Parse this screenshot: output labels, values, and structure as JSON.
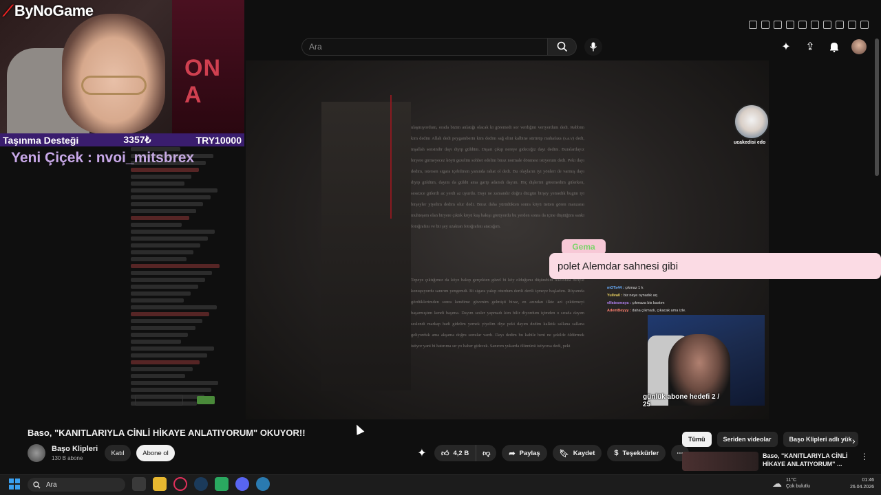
{
  "overlay": {
    "logo": "ByNoGame",
    "webcam_bg_text": "ON A",
    "donation": {
      "label": "Taşınma Desteği",
      "amount": "3357₺",
      "goal": "TRY10000"
    },
    "new_follower": "Yeni Çiçek : nvoi_mitsbrex",
    "bubble_name": "Gema",
    "bubble_message": "polet Alemdar sahnesi gibi",
    "sub_goal": "günlük abone hedefi 2 / 25",
    "cat_name": "ucakedisi edo",
    "right_chat": [
      {
        "user": "mOTs44 :",
        "text": "çıkmaz 1 k"
      },
      {
        "user": "Yullva0 :",
        "text": "biz neye oynadık aq"
      },
      {
        "user": "elfatesmaya :",
        "text": "çıkmaza bis bastım"
      },
      {
        "user": "AdemBeyyy :",
        "text": "daha çıkmadı, çıkacak ama izle."
      }
    ]
  },
  "header": {
    "search_placeholder": "Ara",
    "icons": [
      "upload-icon",
      "notifications-icon",
      "account-avatar"
    ]
  },
  "video": {
    "story_text_1": "ulaşmıyordum, orada bizim anlatığı olacak ki göremedi sor verdiğini veriyordum dedi. Rabbim kim dedim Allah dedi peygamberin kim dedim sağ elini kalbine sürürüp muhafaza (s.a.v) dedi, inşallah sensindir dayı diyip güldüm. Dışarı çıkıp nereye gideceğiz dayı dedim. Buralardayız biryere girmeyecez köyü gezelim sohbet edelim biraz normale dönmesi istiyorum dedi. Peki dayı dedim, istersen sigara içebilirsin yanında rahat ol dedi. Bu olayların iyi yönleri de varmış dayı diyip güldüm, dayım da güldü ama garip adamdı dayım. Hiç dişlerini göremedim gülerken, sessizce gülerdi az yerdi az uyurdu. Dayı ne zamandır doğru düzgün birşey yemedik bugün iyi birşeyler yiyelim dedim olur dedi. Biraz daha yürüdükten sonra köyü üstten gören manzaraı muhteşem olan biryere çıktık köyü kuş bakışı görüyordu bu yerden sonra da içine düştüğüm sanki fotoğrafını ve bir şey uzaktan fotoğrafını atacağım.",
    "story_text_2": "Tepeye çıktığımız da köye bakıp gerçekten güzel bi köy olduğunu düşündüm telefonda biriyle konuşuyordu sanırım yengemdi. Bi sigara yakıp oturdum dertli dertli içmeye başladım. Rüyamda gördüklerimden sonra kendime güvenim gelmişti biraz, en azından ilkte azi çektirmeyi başarmıştım kendi başıma. Dayım sesler yapmadı kim bilir diyordum içimden o sırada dayım seslendi markap hadi gidelim yemek yiyelim diye peki dayım dedim kalktık sallana sallana geliyorduk ama akşama doğru sonular vardı. Dayı dedim bu kabile beni ne şekilde öldürmek istiyor yani bi hatırıma sır yo haber gidecek. Sanırım yukarda ölümünü istiyorsa dedi, peki"
  },
  "left_chat_lines": 38,
  "info": {
    "title": "Baso, \"KANITLARIYLA CİNLİ HİKAYE ANLATIYORUM\" OKUYOR!!",
    "channel_name": "Başo Klipleri",
    "subscribers": "130 B abone",
    "join_label": "Katıl",
    "subscribe_label": "Abone ol",
    "likes": "4,2 B",
    "share_label": "Paylaş",
    "save_label": "Kaydet",
    "thanks_label": "Teşekkürler"
  },
  "related": {
    "tabs": [
      "Tümü",
      "Seriden videolar",
      "Başo Klipleri adlı yük"
    ],
    "video_title": "Baso, \"KANITLARIYLA CİNLİ HİKAYE ANLATIYORUM\" ..."
  },
  "taskbar": {
    "search_label": "Ara",
    "temperature": "11°C",
    "weather": "Çok bulutlu",
    "time": "01:46",
    "date": "26.04.2026"
  },
  "colors": {
    "accent": "#f1f1f1",
    "donation_bg": "#3a1d6e",
    "bubble_bg": "#fbdbe4",
    "bubble_name_color": "#7cd46a"
  }
}
